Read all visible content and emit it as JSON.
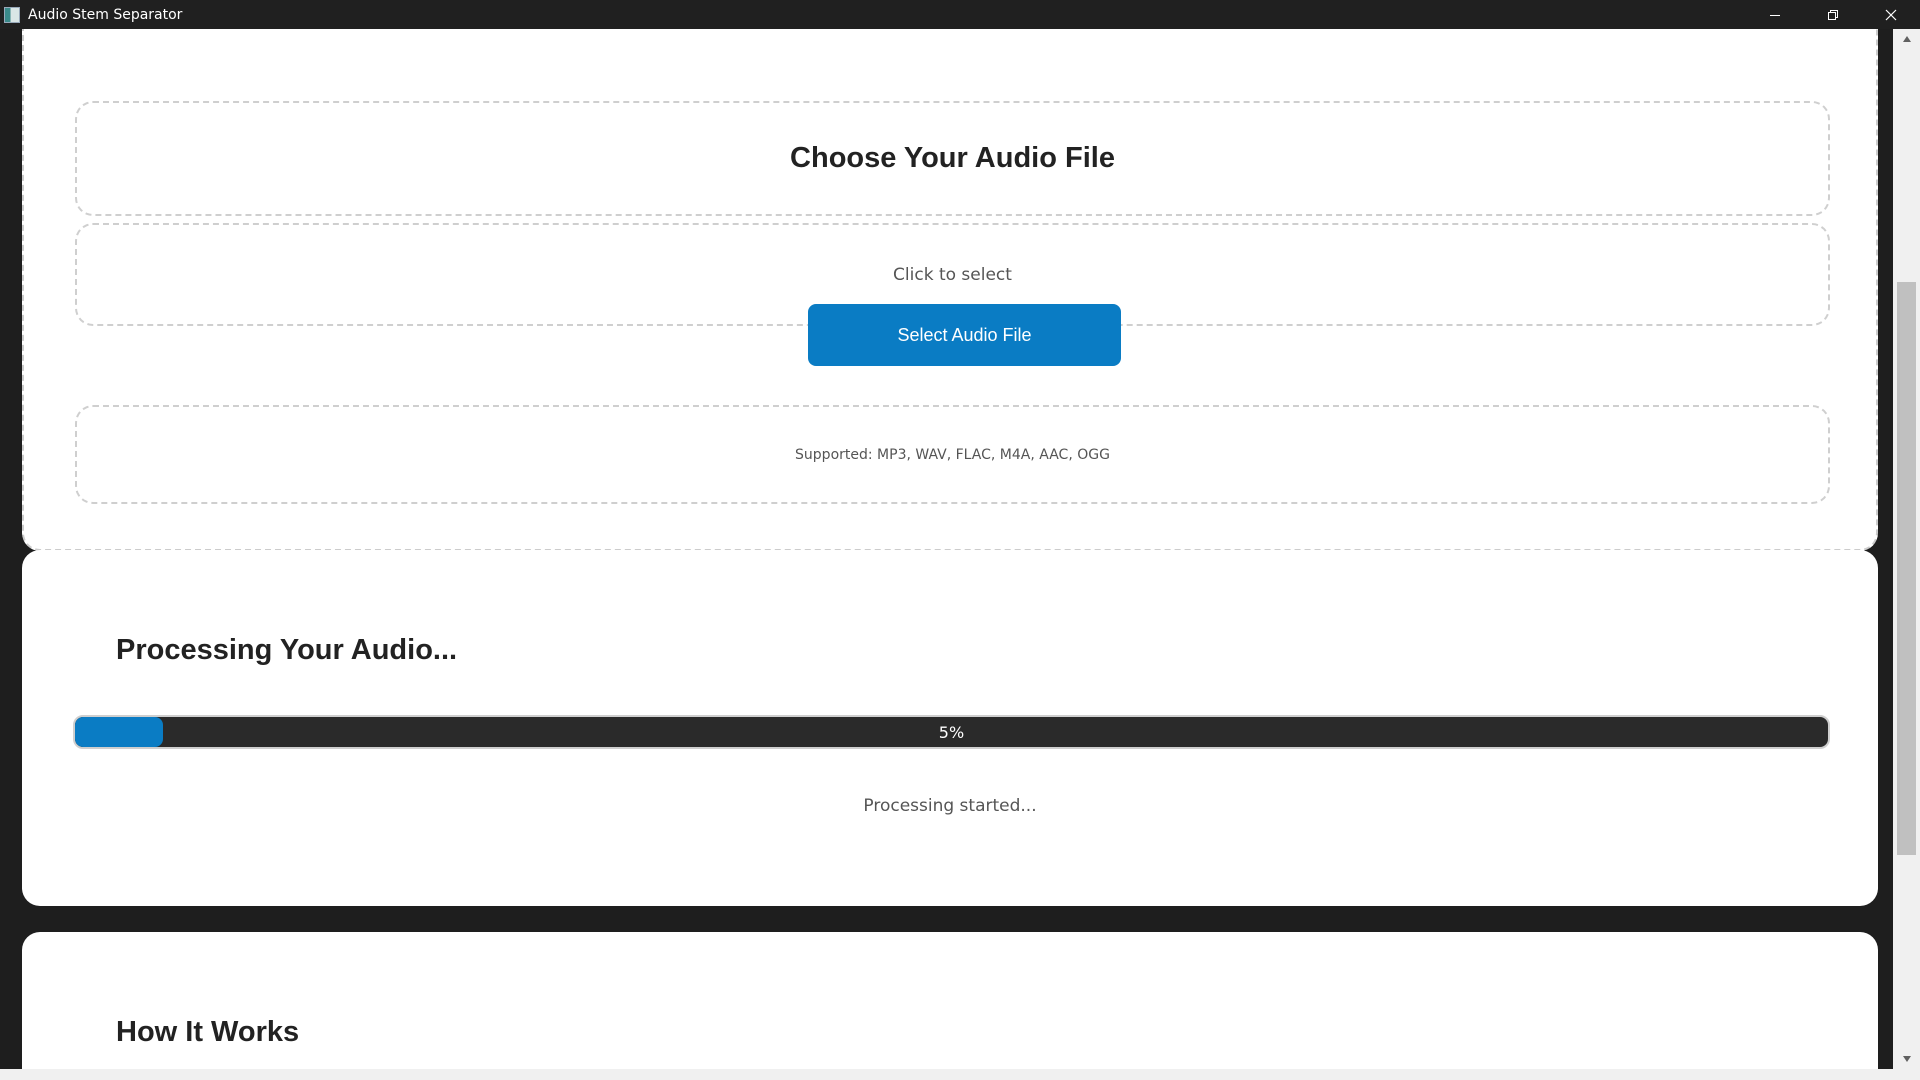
{
  "window": {
    "title": "Audio Stem Separator",
    "controls": [
      "minimize",
      "restore",
      "close"
    ]
  },
  "upload": {
    "title": "Choose Your Audio File",
    "prompt": "Click to select",
    "button_label": "Select Audio File",
    "supported_formats": "Supported: MP3, WAV, FLAC, M4A, AAC, OGG"
  },
  "processing": {
    "heading": "Processing Your Audio...",
    "progress_percent": 5,
    "progress_label": "5%",
    "status": "Processing started..."
  },
  "how_it_works": {
    "heading": "How It Works"
  },
  "colors": {
    "accent": "#0a7cc4",
    "background": "#1e1e1e",
    "card": "#ffffff",
    "progress_track": "#2a2a2a"
  }
}
